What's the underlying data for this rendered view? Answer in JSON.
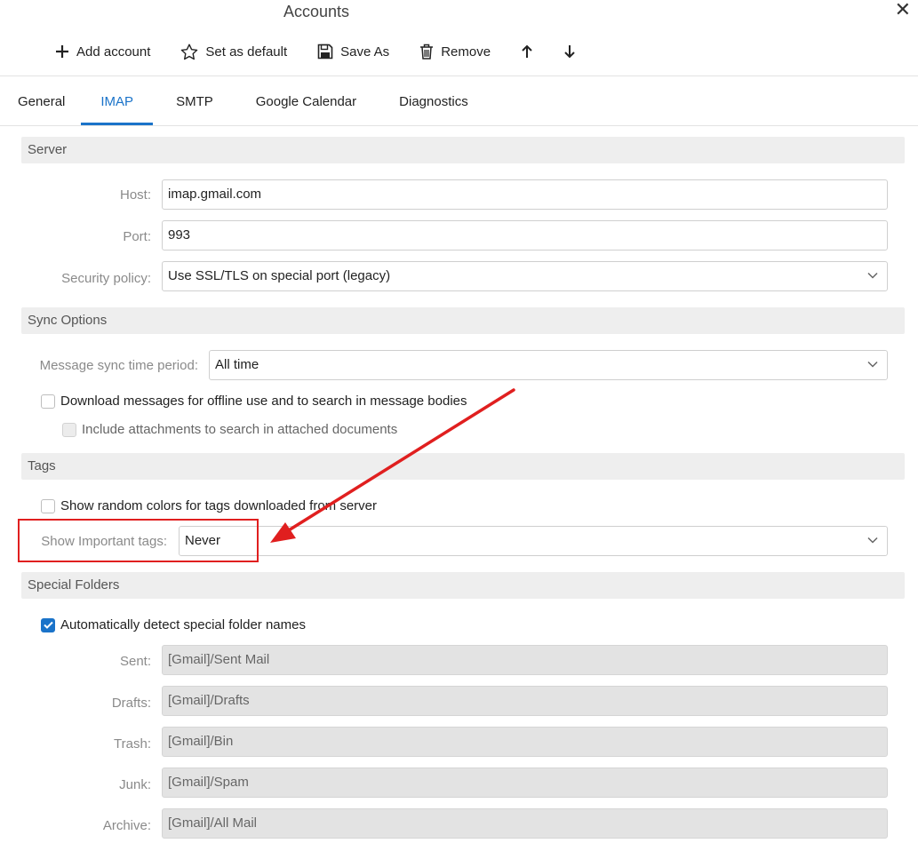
{
  "window": {
    "title": "Accounts"
  },
  "toolbar": {
    "add_label": "Add account",
    "default_label": "Set as default",
    "saveas_label": "Save As",
    "remove_label": "Remove"
  },
  "tabs": [
    {
      "label": "General"
    },
    {
      "label": "IMAP"
    },
    {
      "label": "SMTP"
    },
    {
      "label": "Google Calendar"
    },
    {
      "label": "Diagnostics"
    }
  ],
  "active_tab": "IMAP",
  "server": {
    "section_label": "Server",
    "host_label": "Host:",
    "host_value": "imap.gmail.com",
    "port_label": "Port:",
    "port_value": "993",
    "security_label": "Security policy:",
    "security_value": "Use SSL/TLS on special port (legacy)"
  },
  "sync": {
    "section_label": "Sync Options",
    "period_label": "Message sync time period:",
    "period_value": "All time",
    "offline_label": "Download messages for offline use and to search in message bodies",
    "offline_checked": false,
    "attachments_label": "Include attachments to search in attached documents",
    "attachments_checked": false
  },
  "tags": {
    "section_label": "Tags",
    "random_colors_label": "Show random colors for tags downloaded from server",
    "random_colors_checked": false,
    "important_label": "Show Important tags:",
    "important_value": "Never"
  },
  "special_folders": {
    "section_label": "Special Folders",
    "auto_detect_label": "Automatically detect special folder names",
    "auto_detect_checked": true,
    "sent_label": "Sent:",
    "sent_value": "[Gmail]/Sent Mail",
    "drafts_label": "Drafts:",
    "drafts_value": "[Gmail]/Drafts",
    "trash_label": "Trash:",
    "trash_value": "[Gmail]/Bin",
    "junk_label": "Junk:",
    "junk_value": "[Gmail]/Spam",
    "archive_label": "Archive:",
    "archive_value": "[Gmail]/All Mail"
  },
  "colors": {
    "accent": "#1a73c9",
    "annotation": "#e01f1f",
    "section_bg": "#eeeeee",
    "disabled_field": "#e3e3e3"
  },
  "icons": {
    "add": "plus-icon",
    "default": "star-icon",
    "saveas": "floppy-disk-icon",
    "remove": "trash-icon",
    "up": "arrow-up-icon",
    "down": "arrow-down-icon",
    "close": "close-icon",
    "dropdown": "chevron-down-icon"
  }
}
